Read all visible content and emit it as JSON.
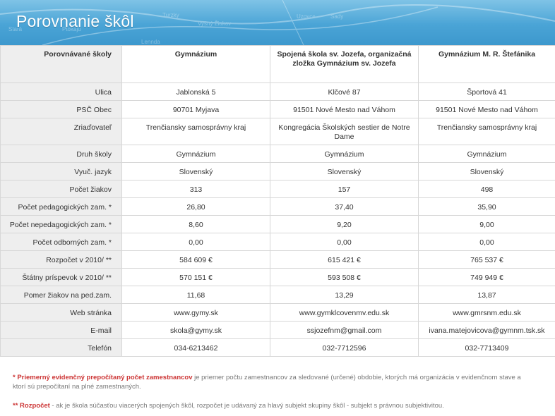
{
  "page": {
    "title": "Porovnanie škôl",
    "map_labels": [
      "Turzky",
      "Vyšný Žiakov",
      "Lennda",
      "Stará",
      "Ptokajú",
      "Uzovce",
      "Sady"
    ]
  },
  "table": {
    "header": {
      "label": "Porovnávané školy",
      "schools": [
        "Gymnázium",
        "Spojená škola sv. Jozefa, organizačná zložka Gymnázium sv. Jozefa",
        "Gymnázium M. R. Štefánika"
      ]
    },
    "rows": [
      {
        "label": "Ulica",
        "values": [
          "Jablonská 5",
          "Klčové 87",
          "Športová 41"
        ]
      },
      {
        "label": "PSČ Obec",
        "values": [
          "90701 Myjava",
          "91501 Nové Mesto nad Váhom",
          "91501 Nové Mesto nad Váhom"
        ]
      },
      {
        "label": "Zriaďovateľ",
        "values": [
          "Trenčiansky samosprávny kraj",
          "Kongregácia Školských sestier de Notre Dame",
          "Trenčiansky samosprávny kraj"
        ]
      },
      {
        "label": "Druh školy",
        "values": [
          "Gymnázium",
          "Gymnázium",
          "Gymnázium"
        ]
      },
      {
        "label": "Vyuč. jazyk",
        "values": [
          "Slovenský",
          "Slovenský",
          "Slovenský"
        ]
      },
      {
        "label": "Počet žiakov",
        "values": [
          "313",
          "157",
          "498"
        ]
      },
      {
        "label": "Počet pedagogických zam. *",
        "values": [
          "26,80",
          "37,40",
          "35,90"
        ]
      },
      {
        "label": "Počet nepedagogických zam. *",
        "values": [
          "8,60",
          "9,20",
          "9,00"
        ]
      },
      {
        "label": "Počet odborných zam. *",
        "values": [
          "0,00",
          "0,00",
          "0,00"
        ]
      },
      {
        "label": "Rozpočet v 2010/ **",
        "values": [
          "584 609 €",
          "615 421 €",
          "765 537 €"
        ]
      },
      {
        "label": "Štátny príspevok v 2010/ **",
        "values": [
          "570 151 €",
          "593 508 €",
          "749 949 €"
        ]
      },
      {
        "label": "Pomer žiakov na ped.zam.",
        "values": [
          "11,68",
          "13,29",
          "13,87"
        ]
      },
      {
        "label": "Web stránka",
        "values": [
          "www.gymy.sk",
          "www.gymklcovenmv.edu.sk",
          "www.gmrsnm.edu.sk"
        ]
      },
      {
        "label": "E-mail",
        "values": [
          "skola@gymy.sk",
          "ssjozefnm@gmail.com",
          "ivana.matejovicova@gymnm.tsk.sk"
        ]
      },
      {
        "label": "Telefón",
        "values": [
          "034-6213462",
          "032-7712596",
          "032-7713409"
        ]
      }
    ]
  },
  "notes": {
    "n1_mark": "*",
    "n1_bold": "Priemerný evidenčný prepočítaný počet zamestnancov",
    "n1_text": " je priemer počtu zamestnancov za sledované (určené) obdobie, ktorých má organizácia v evidenčnom stave a ktorí sú prepočítaní na plné zamestnaných.",
    "n2_mark": "**",
    "n2_bold": "Rozpočet",
    "n2_text": " - ak je škola súčasťou viacerých spojených škôl, rozpočet je udávaný za hlavý subjekt skupiny škôl - subjekt s právnou subjektivitou."
  }
}
